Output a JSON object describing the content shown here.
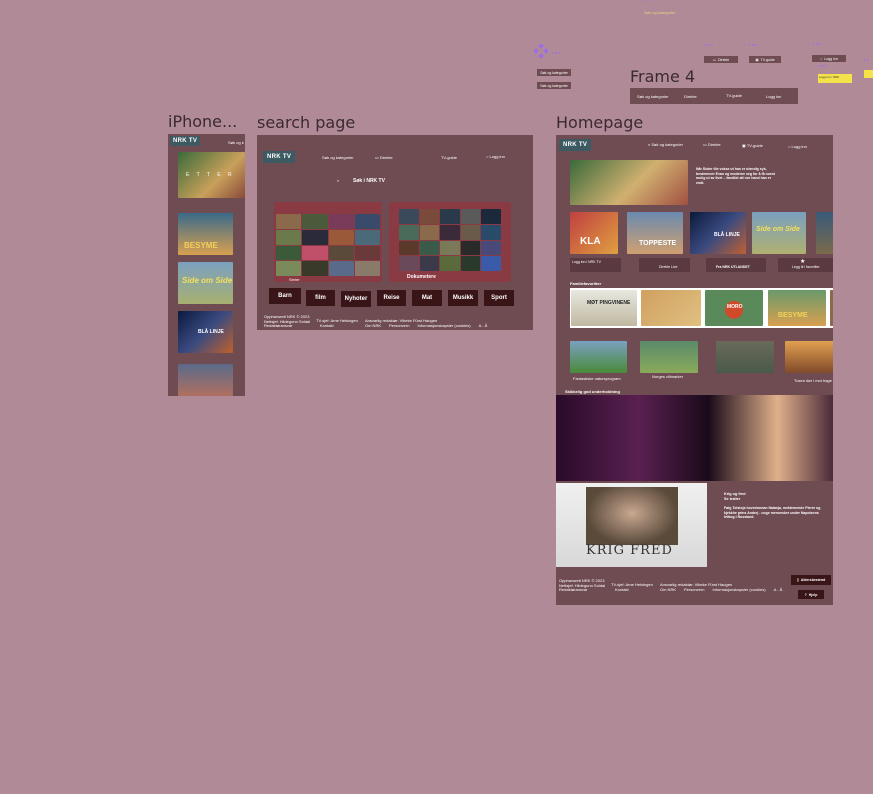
{
  "top_note": "Søk og kategorier",
  "components": {
    "item1": "Søk og kategorier",
    "item2": "Søk og kategorier",
    "direkte": "Direkte",
    "tv_guide": "TV-guide",
    "logg_inn": "Logg inn",
    "yellow_note": "Logg inn / NRK"
  },
  "frame4": {
    "label": "Frame 4",
    "items": [
      "Søk og kategorier",
      "Direkte",
      "TV-guide",
      "Logg inn"
    ]
  },
  "iphone": {
    "label": "iPhone...",
    "logo": "NRK TV",
    "search": "Søk og k",
    "poster_texts": [
      "E T T E R",
      "BESYME",
      "Side om Side",
      "BLÅ LINJE",
      ""
    ]
  },
  "search_page": {
    "label": "search page",
    "logo": "NRK TV",
    "nav": [
      "Søk og kategorier",
      "Direkte",
      "TV-guide",
      "Logg inn"
    ],
    "search_text": "Søk i NRK TV",
    "card1_label": "Serier",
    "card2_label": "Dokumetere",
    "categories": [
      "Barn",
      "film",
      "Nyhoter",
      "Reise",
      "Mat",
      "Musikk",
      "Sport"
    ],
    "footer": {
      "col1": [
        "Opphavsrett NRK © 2023",
        "Nettsjef: Hildegunn Soldal",
        "Redaktøransvar"
      ],
      "col2": [
        "TV-sjef: Arne Helsingen",
        "Kontakt"
      ],
      "col3": [
        "Ansvarlig redaktør: Vibeke Fürst Haugen",
        "Om NRK",
        "Personvern",
        "Informasjonskapsler (cookies)",
        "A - Å"
      ]
    }
  },
  "homepage": {
    "label": "Homepage",
    "logo": "NRK TV",
    "nav": [
      "Søk og kategorier",
      "Direkte",
      "TV-guide",
      "Logg inn"
    ],
    "hero_text": "Når Sister tile vokse ut han er utendig syk, bestemmer Evan og moderne seg for å få noest mulig ut av livet – familiet alt nor hand han er endt.",
    "row1": [
      "KLA",
      "TOPPESTE",
      "BLÅ LINJE",
      "Side om Side",
      ""
    ],
    "quick_links": [
      "Logg inn i NRK TV",
      "Direkte Live",
      "Fra NRK UTLANDET",
      "Legg til i favoritter"
    ],
    "section_family": "Familiefavoritter",
    "family_posters": [
      "MØT PINGVINENE",
      "",
      "MORO",
      "BESYME",
      ""
    ],
    "row3_captions": [
      "Fantastiske natursprogram",
      "Norges villmarker",
      "",
      "Tusen dør i mot hage"
    ],
    "section_historical": "Skikkelig god underholdning",
    "krig_title": "Krig og fred",
    "krig_subtitle": "Se trailer",
    "krig_desc": "Følg Tolstojs hovedroman Natasja, mektemende Pierre og kjekkhe prins Andrej - unge mennesker under Napoleons felttog i Russland.",
    "krig_overlay": "KRIG FRED",
    "footer": {
      "col1": [
        "Opphavsrett NRK © 2023",
        "Nettsjef: Hildegunn Soldal",
        "Redaktøransvar"
      ],
      "col2": [
        "TV-sjef: Arne Helsingen",
        "Kontakt"
      ],
      "col3": [
        "Ansvarlig redaktør: Vibeke Fürst Haugen",
        "Om NRK",
        "Personvern",
        "Informasjonskapsler (cookies)",
        "A - Å"
      ]
    },
    "buttons": [
      "Aldersbestemt",
      "Hjelp"
    ]
  },
  "colors": {
    "canvas": "#b18a98",
    "frame": "#6f4b52",
    "dark_button": "#3a1518",
    "nrk_logo": "#3d5a63",
    "accent_purple": "#9b6de8",
    "yellow_note": "#f5e24a"
  }
}
